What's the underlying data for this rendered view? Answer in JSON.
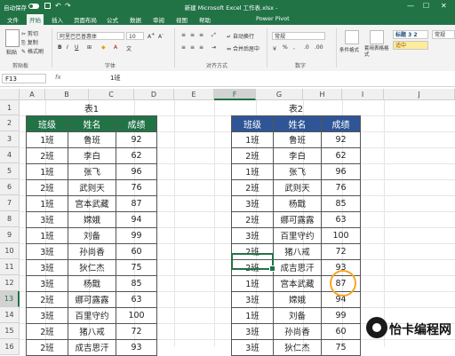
{
  "titlebar": {
    "autosave": "自动保存",
    "toggle": "关",
    "title": "新建 Microsoft Excel 工作表.xlsx -",
    "minimize": "—",
    "maximize": "☐",
    "close": "✕"
  },
  "menu": {
    "tabs": [
      "文件",
      "开始",
      "插入",
      "页面布局",
      "公式",
      "数据",
      "审阅",
      "视图",
      "帮助",
      "Power Pivot"
    ]
  },
  "ribbon": {
    "paste": "粘贴",
    "cut": "剪切",
    "copy": "复制",
    "format_painter": "格式刷",
    "clipboard": "剪贴板",
    "font_name": "阿里巴巴普惠体",
    "font_size": "10",
    "font_group": "字体",
    "wrap": "自动换行",
    "merge": "合并后居中",
    "align_group": "对齐方式",
    "number_format": "常规",
    "number_group": "数字",
    "cond_format": "条件格式",
    "table_format": "套用表格格式",
    "style_heading": "标题 3 2",
    "style_good": "适中",
    "style_normal": "常规"
  },
  "formula": {
    "cell_ref": "F13",
    "fx": "fx",
    "content": "1班"
  },
  "columns": [
    "A",
    "B",
    "C",
    "D",
    "E",
    "F",
    "G",
    "H",
    "I",
    "J"
  ],
  "rows": [
    "1",
    "2",
    "3",
    "4",
    "5",
    "6",
    "7",
    "8",
    "9",
    "10",
    "11",
    "12",
    "13",
    "14",
    "15",
    "16",
    "17",
    "18",
    "19"
  ],
  "colors": {
    "table1_header": "#217346",
    "table2_header": "#2f5597",
    "excel_green": "#217346"
  },
  "table1": {
    "title": "表1",
    "headers": [
      "班级",
      "姓名",
      "成绩"
    ],
    "rows": [
      [
        "1班",
        "鲁班",
        "92"
      ],
      [
        "2班",
        "李白",
        "62"
      ],
      [
        "1班",
        "张飞",
        "96"
      ],
      [
        "2班",
        "武则天",
        "76"
      ],
      [
        "1班",
        "宫本武藏",
        "87"
      ],
      [
        "3班",
        "嫦娥",
        "94"
      ],
      [
        "1班",
        "刘备",
        "99"
      ],
      [
        "3班",
        "孙尚香",
        "60"
      ],
      [
        "3班",
        "狄仁杰",
        "75"
      ],
      [
        "3班",
        "杨戬",
        "85"
      ],
      [
        "2班",
        "娜可露露",
        "63"
      ],
      [
        "3班",
        "百里守约",
        "100"
      ],
      [
        "2班",
        "猪八戒",
        "72"
      ],
      [
        "2班",
        "成吉思汗",
        "93"
      ]
    ]
  },
  "table2": {
    "title": "表2",
    "headers": [
      "班级",
      "姓名",
      "成绩"
    ],
    "rows": [
      [
        "1班",
        "鲁班",
        "92"
      ],
      [
        "2班",
        "李白",
        "62"
      ],
      [
        "1班",
        "张飞",
        "96"
      ],
      [
        "2班",
        "武则天",
        "76"
      ],
      [
        "3班",
        "杨戬",
        "85"
      ],
      [
        "2班",
        "娜可露露",
        "63"
      ],
      [
        "3班",
        "百里守约",
        "100"
      ],
      [
        "2班",
        "猪八戒",
        "72"
      ],
      [
        "2班",
        "成吉思汗",
        "93"
      ],
      [
        "1班",
        "宫本武藏",
        "87"
      ],
      [
        "3班",
        "嫦娥",
        "94"
      ],
      [
        "1班",
        "刘备",
        "99"
      ],
      [
        "3班",
        "孙尚香",
        "60"
      ],
      [
        "3班",
        "狄仁杰",
        "75"
      ]
    ]
  },
  "watermark": {
    "text": "怡卡编程网"
  }
}
